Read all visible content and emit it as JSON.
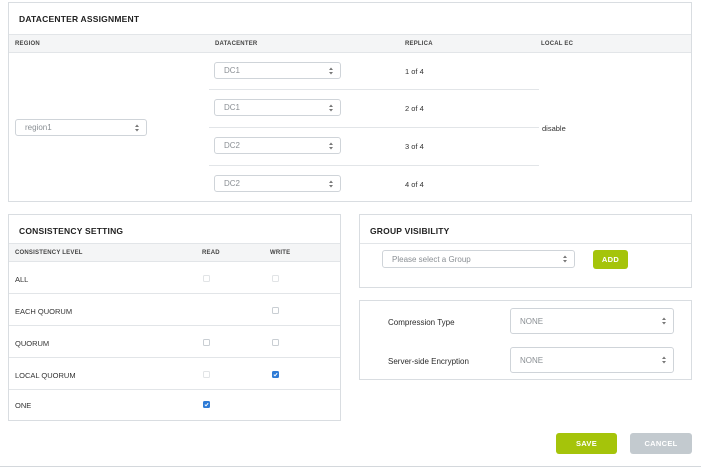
{
  "datacenter_assignment": {
    "title": "DATACENTER ASSIGNMENT",
    "columns": {
      "region": "REGION",
      "datacenter": "DATACENTER",
      "replica": "REPLICA",
      "local_ec": "LOCAL EC"
    },
    "region_value": "region1",
    "local_ec_value": "disable",
    "rows": [
      {
        "datacenter": "DC1",
        "replica": "1 of 4"
      },
      {
        "datacenter": "DC1",
        "replica": "2 of 4"
      },
      {
        "datacenter": "DC2",
        "replica": "3 of 4"
      },
      {
        "datacenter": "DC2",
        "replica": "4 of 4"
      }
    ]
  },
  "consistency_setting": {
    "title": "CONSISTENCY SETTING",
    "columns": {
      "level": "CONSISTENCY LEVEL",
      "read": "READ",
      "write": "WRITE"
    },
    "rows": [
      {
        "level": "ALL",
        "read": "unchecked",
        "write": "unchecked",
        "read_disabled": true,
        "write_disabled": true
      },
      {
        "level": "EACH QUORUM",
        "read": "none",
        "write": "unchecked",
        "read_disabled": false,
        "write_disabled": false
      },
      {
        "level": "QUORUM",
        "read": "unchecked",
        "write": "unchecked",
        "read_disabled": false,
        "write_disabled": false
      },
      {
        "level": "LOCAL QUORUM",
        "read": "unchecked",
        "write": "checked",
        "read_disabled": true,
        "write_disabled": false
      },
      {
        "level": "ONE",
        "read": "checked",
        "write": "none",
        "read_disabled": false,
        "write_disabled": false
      }
    ]
  },
  "group_visibility": {
    "title": "GROUP VISIBILITY",
    "select_placeholder": "Please select a Group",
    "add_label": "ADD"
  },
  "options": {
    "compression_label": "Compression Type",
    "compression_value": "NONE",
    "encryption_label": "Server-side Encryption",
    "encryption_value": "NONE"
  },
  "footer": {
    "save_label": "SAVE",
    "cancel_label": "CANCEL"
  },
  "colors": {
    "accent_green": "#a5c40a",
    "checkbox_blue": "#2e7bd6",
    "disabled_grey": "#c3cacf"
  }
}
